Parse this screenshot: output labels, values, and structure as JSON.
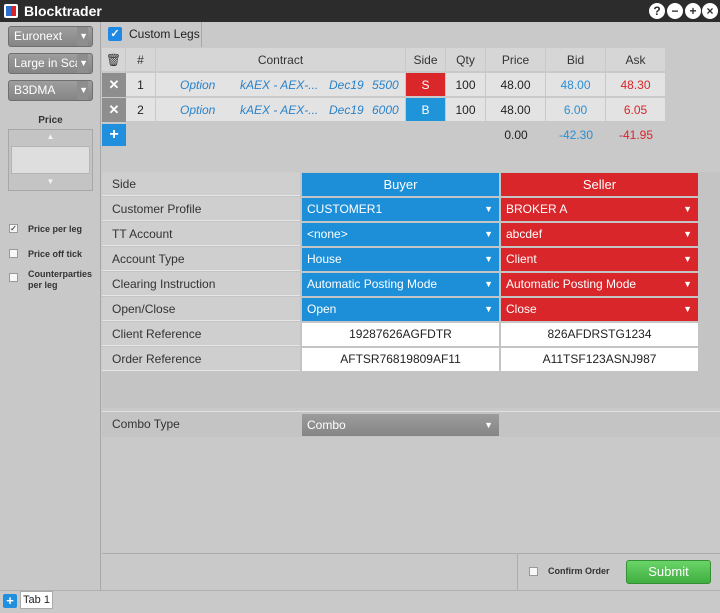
{
  "app": {
    "title": "Blocktrader"
  },
  "window_buttons": [
    "?",
    "−",
    "+",
    "×"
  ],
  "left": {
    "exchange": "Euronext",
    "size": "Large in Sca",
    "venue": "B3DMA",
    "price_label": "Price",
    "options": [
      {
        "label": "Price per leg",
        "checked": true
      },
      {
        "label": "Price off tick",
        "checked": false
      },
      {
        "label": "Counterparties per leg",
        "checked": false
      }
    ]
  },
  "custom_legs": {
    "label": "Custom Legs",
    "checked": true
  },
  "grid": {
    "headers": [
      "#",
      "Contract",
      "Side",
      "Qty",
      "Price",
      "Bid",
      "Ask"
    ],
    "legs": [
      {
        "num": "1",
        "type": "Option",
        "product": "kAEX - AEX-...",
        "expiry": "Dec19",
        "strike": "5500",
        "side": "S",
        "qty": "100",
        "price": "48.00",
        "bid": "48.00",
        "ask": "48.30"
      },
      {
        "num": "2",
        "type": "Option",
        "product": "kAEX - AEX-...",
        "expiry": "Dec19",
        "strike": "6000",
        "side": "B",
        "qty": "100",
        "price": "48.00",
        "bid": "6.00",
        "ask": "6.05"
      }
    ],
    "totals": {
      "price": "0.00",
      "bid": "-42.30",
      "ask": "-41.95"
    }
  },
  "form": {
    "side_label": "Side",
    "buyer": "Buyer",
    "seller": "Seller",
    "rows": [
      {
        "label": "Customer Profile",
        "buy": "CUSTOMER1",
        "sell": "BROKER A"
      },
      {
        "label": "TT Account",
        "buy": "<none>",
        "sell": "abcdef"
      },
      {
        "label": "Account Type",
        "buy": "House",
        "sell": "Client"
      },
      {
        "label": "Clearing Instruction",
        "buy": "Automatic Posting Mode",
        "sell": "Automatic Posting Mode"
      },
      {
        "label": "Open/Close",
        "buy": "Open",
        "sell": "Close"
      }
    ],
    "text_rows": [
      {
        "label": "Client Reference",
        "buy": "19287626AGFDTR",
        "sell": "826AFDRSTG1234"
      },
      {
        "label": "Order Reference",
        "buy": "AFTSR76819809AF11",
        "sell": "A11TSF123ASNJ987"
      }
    ]
  },
  "combo": {
    "label": "Combo Type",
    "value": "Combo"
  },
  "confirm": {
    "label": "Confirm Order",
    "checked": false
  },
  "submit_label": "Submit",
  "tabs": [
    {
      "label": "Tab 1"
    }
  ],
  "colors": {
    "buyer": "#1c8fd8",
    "seller": "#d8262a",
    "submit": "#4cbc4b",
    "accent": "#1f8fde"
  }
}
